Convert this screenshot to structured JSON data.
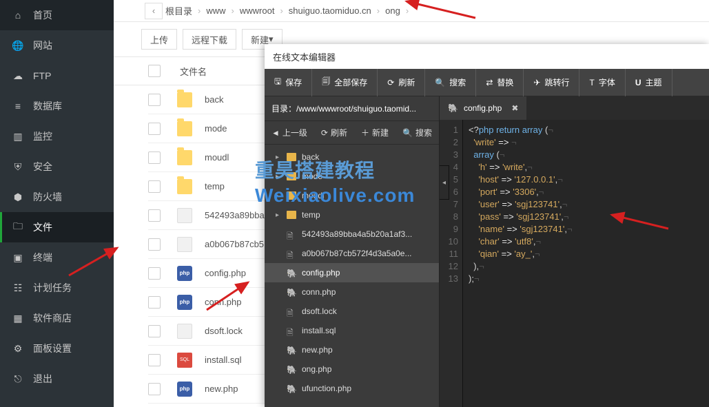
{
  "sidebar": [
    {
      "id": "home",
      "label": "首页",
      "icon": "home"
    },
    {
      "id": "site",
      "label": "网站",
      "icon": "globe"
    },
    {
      "id": "ftp",
      "label": "FTP",
      "icon": "cloud"
    },
    {
      "id": "db",
      "label": "数据库",
      "icon": "database"
    },
    {
      "id": "monitor",
      "label": "监控",
      "icon": "chart"
    },
    {
      "id": "security",
      "label": "安全",
      "icon": "shield"
    },
    {
      "id": "firewall",
      "label": "防火墙",
      "icon": "firewall"
    },
    {
      "id": "file",
      "label": "文件",
      "icon": "folder",
      "active": true
    },
    {
      "id": "terminal",
      "label": "终端",
      "icon": "terminal"
    },
    {
      "id": "cron",
      "label": "计划任务",
      "icon": "calendar"
    },
    {
      "id": "store",
      "label": "软件商店",
      "icon": "grid"
    },
    {
      "id": "panel",
      "label": "面板设置",
      "icon": "gear"
    },
    {
      "id": "logout",
      "label": "退出",
      "icon": "exit"
    }
  ],
  "breadcrumb": [
    "根目录",
    "www",
    "wwwroot",
    "shuiguo.taomiduo.cn",
    "ong"
  ],
  "toolbar": {
    "upload": "上传",
    "remote": "远程下载",
    "create": "新建"
  },
  "fileHead": "文件名",
  "files": [
    {
      "name": "back",
      "icon": "folder"
    },
    {
      "name": "mode",
      "icon": "folder"
    },
    {
      "name": "moudl",
      "icon": "folder"
    },
    {
      "name": "temp",
      "icon": "folder"
    },
    {
      "name": "542493a89bba",
      "icon": "file"
    },
    {
      "name": "a0b067b87cb5",
      "icon": "file"
    },
    {
      "name": "config.php",
      "icon": "php"
    },
    {
      "name": "conn.php",
      "icon": "php"
    },
    {
      "name": "dsoft.lock",
      "icon": "file"
    },
    {
      "name": "install.sql",
      "icon": "sql"
    },
    {
      "name": "new.php",
      "icon": "php"
    }
  ],
  "editor": {
    "title": "在线文本编辑器",
    "toolbar": {
      "save": "保存",
      "saveAll": "全部保存",
      "refresh": "刷新",
      "search": "搜索",
      "replace": "替换",
      "gotoline": "跳转行",
      "font": "字体",
      "theme": "主题"
    },
    "treePath": "目录：/www/wwwroot/shuiguo.taomid...",
    "treeNav": {
      "up": "上一级",
      "refresh": "刷新",
      "create": "新建",
      "search": "搜索"
    },
    "tree": [
      {
        "name": "back",
        "kind": "folder"
      },
      {
        "name": "mode",
        "kind": "folder"
      },
      {
        "name": "moudl",
        "kind": "folder"
      },
      {
        "name": "temp",
        "kind": "folder"
      },
      {
        "name": "542493a89bba4a5b20a1af3...",
        "kind": "file"
      },
      {
        "name": "a0b067b87cb572f4d3a5a0e...",
        "kind": "file"
      },
      {
        "name": "config.php",
        "kind": "php",
        "active": true
      },
      {
        "name": "conn.php",
        "kind": "php"
      },
      {
        "name": "dsoft.lock",
        "kind": "file"
      },
      {
        "name": "install.sql",
        "kind": "file"
      },
      {
        "name": "new.php",
        "kind": "php"
      },
      {
        "name": "ong.php",
        "kind": "php"
      },
      {
        "name": "ufunction.php",
        "kind": "php"
      }
    ],
    "tab": "config.php",
    "code": {
      "lines": [
        "<?php return array (",
        "  'write' => ",
        "  array (",
        "    'h' => 'write',",
        "    'host' => '127.0.0.1',",
        "    'port' => '3306',",
        "    'user' => 'sgj123741',",
        "    'pass' => 'sgj123741',",
        "    'name' => 'sgj123741',",
        "    'char' => 'utf8',",
        "    'qian' => 'ay_',",
        "  ),",
        ");"
      ]
    }
  },
  "watermark": {
    "l1": "重昊搭建教程",
    "l2": "Weixiaolive.com"
  }
}
